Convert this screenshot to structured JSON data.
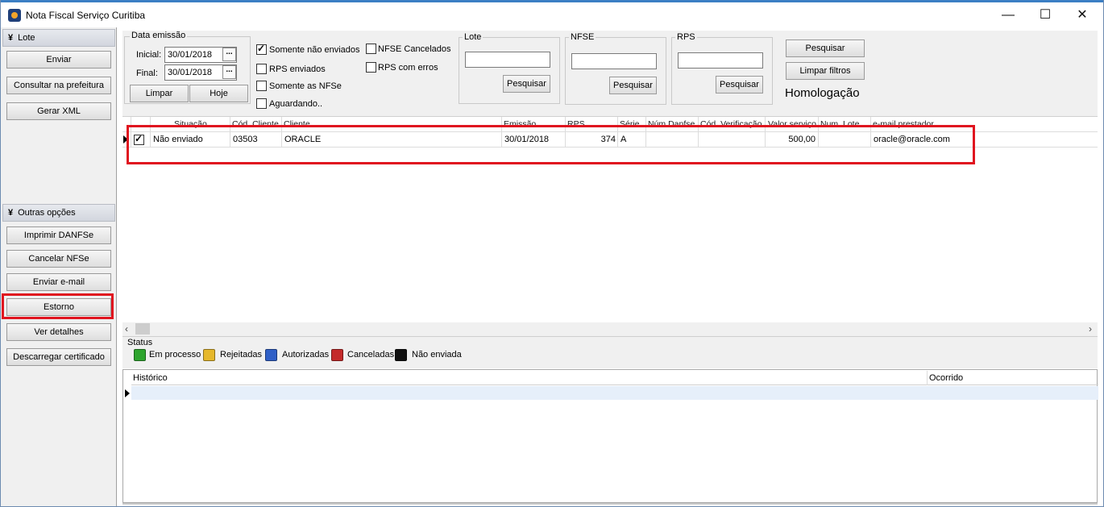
{
  "window": {
    "title": "Nota Fiscal Serviço Curitiba",
    "minimize_glyph": "—",
    "maximize_glyph": "☐",
    "close_glyph": "✕"
  },
  "sidebar": {
    "lote_header": "Lote",
    "lote_buttons": [
      "Enviar",
      "Consultar na prefeitura",
      "Gerar XML"
    ],
    "outras_header": "Outras opções",
    "outras_buttons": [
      "Imprimir DANFSe",
      "Cancelar NFSe",
      "Enviar e-mail",
      "Estorno",
      "Ver detalhes",
      "Descarregar certificado"
    ],
    "chevron": "¥"
  },
  "filters": {
    "data_emissao": {
      "caption": "Data emissão",
      "inicial_label": "Inicial:",
      "inicial_value": "30/01/2018",
      "final_label": "Final:",
      "final_value": "30/01/2018",
      "limpar": "Limpar",
      "hoje": "Hoje",
      "ellipsis": "..."
    },
    "checkboxes": [
      {
        "label": "Somente não enviados",
        "checked": true
      },
      {
        "label": "RPS enviados",
        "checked": false
      },
      {
        "label": "Somente as NFSe",
        "checked": false
      },
      {
        "label": "Aguardando..",
        "checked": false
      },
      {
        "label": "NFSE Cancelados",
        "checked": false
      },
      {
        "label": "RPS com erros",
        "checked": false
      }
    ],
    "lote": {
      "caption": "Lote",
      "value": "",
      "button": "Pesquisar"
    },
    "nfse": {
      "caption": "NFSE",
      "value": "",
      "button": "Pesquisar"
    },
    "rps": {
      "caption": "RPS",
      "value": "",
      "button": "Pesquisar"
    },
    "pesquisar": "Pesquisar",
    "limpar_filtros": "Limpar filtros",
    "ambiente": "Homologação"
  },
  "grid": {
    "headers": [
      "Situação",
      "Cód. Cliente",
      "Cliente",
      "Emissão",
      "RPS",
      "Série",
      "Núm Danfse",
      "Cód. Verificação",
      "Valor serviço",
      "Num. Lote",
      "e-mail prestador"
    ],
    "rows": [
      {
        "selected": true,
        "situacao": "Não enviado",
        "cod_cliente": "03503",
        "cliente": "ORACLE",
        "emissao": "30/01/2018",
        "rps": "374",
        "serie": "A",
        "num_danfse": "",
        "cod_verificacao": "",
        "valor_servico": "500,00",
        "num_lote": "",
        "email_prestador": "oracle@oracle.com"
      }
    ]
  },
  "status": {
    "caption": "Status",
    "legend": [
      {
        "label": "Em processo",
        "color": "#2ea52e"
      },
      {
        "label": "Rejeitadas",
        "color": "#e6b82c"
      },
      {
        "label": "Autorizadas",
        "color": "#2f5fc7"
      },
      {
        "label": "Canceladas",
        "color": "#c42a2a"
      },
      {
        "label": "Não enviada",
        "color": "#111111"
      }
    ]
  },
  "historico": {
    "col_historico": "Histórico",
    "col_ocorrido": "Ocorrido"
  },
  "colors": {
    "highlight_red": "#e0141f",
    "accent_blue": "#3b7fc4"
  }
}
